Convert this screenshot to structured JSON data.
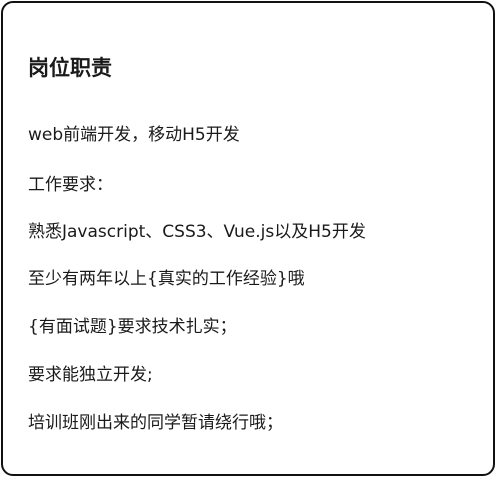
{
  "job": {
    "heading": "岗位职责",
    "lines": [
      "web前端开发，移动H5开发",
      "工作要求：",
      "熟悉Javascript、CSS3、Vue.js以及H5开发",
      "至少有两年以上{真实的工作经验}哦",
      "{有面试题}要求技术扎实；",
      "要求能独立开发;",
      "培训班刚出来的同学暂请绕行哦；"
    ]
  }
}
